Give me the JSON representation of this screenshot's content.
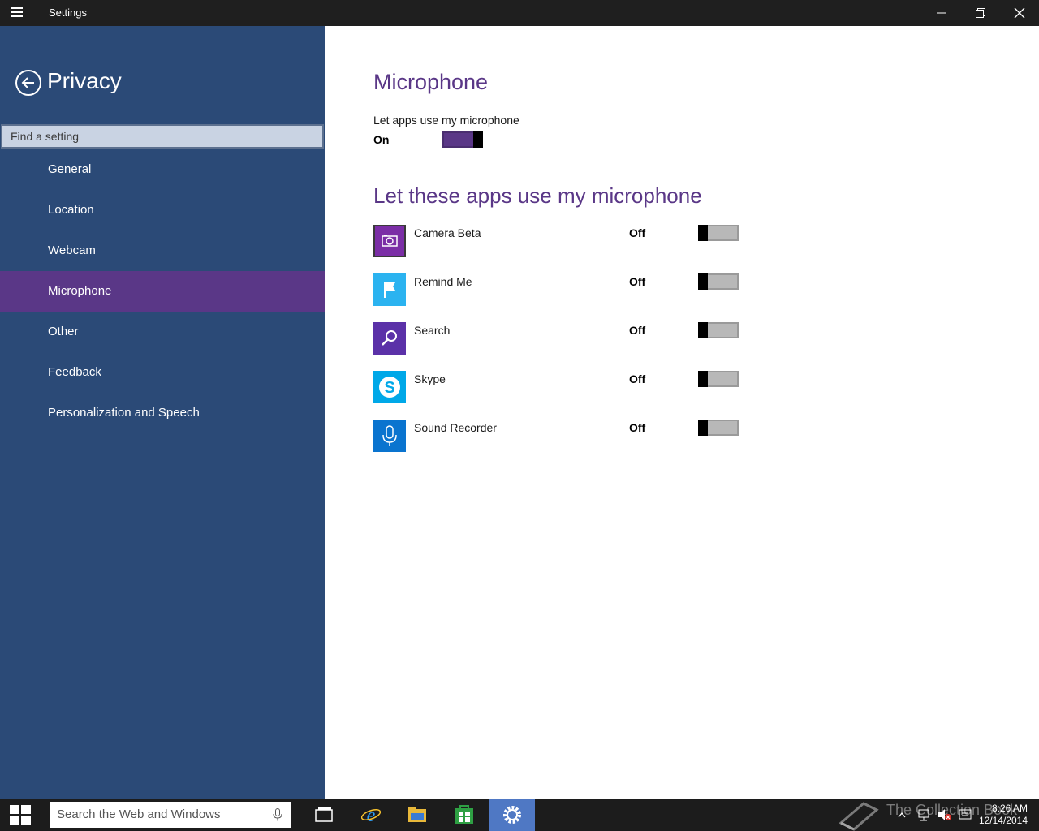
{
  "window": {
    "title": "Settings"
  },
  "sidebar": {
    "heading": "Privacy",
    "search_placeholder": "Find a setting",
    "items": [
      {
        "label": "General"
      },
      {
        "label": "Location"
      },
      {
        "label": "Webcam"
      },
      {
        "label": "Microphone",
        "active": true
      },
      {
        "label": "Other"
      },
      {
        "label": "Feedback"
      },
      {
        "label": "Personalization and Speech"
      }
    ]
  },
  "main": {
    "title": "Microphone",
    "master_label": "Let apps use my microphone",
    "master_state": "On",
    "section_title": "Let these apps use my microphone",
    "apps": [
      {
        "name": "Camera Beta",
        "state": "Off",
        "icon": "camera-icon",
        "color": "#7b2ea6"
      },
      {
        "name": "Remind Me",
        "state": "Off",
        "icon": "flag-icon",
        "color": "#2bb3f0"
      },
      {
        "name": "Search",
        "state": "Off",
        "icon": "search-icon",
        "color": "#5b31a8"
      },
      {
        "name": "Skype",
        "state": "Off",
        "icon": "skype-icon",
        "color": "#00a8e8"
      },
      {
        "name": "Sound Recorder",
        "state": "Off",
        "icon": "microphone-icon",
        "color": "#0a74cf"
      }
    ]
  },
  "taskbar": {
    "search_placeholder": "Search the Web and Windows",
    "watermark": "The Collection Book",
    "time": "8:26 AM",
    "date": "12/14/2014"
  },
  "colors": {
    "accent": "#5a3787",
    "sidebar": "#2b4a77",
    "taskbar": "#1c1c1c"
  }
}
